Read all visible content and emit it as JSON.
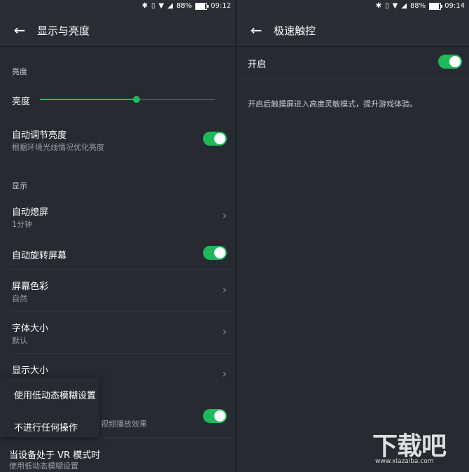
{
  "left": {
    "status": {
      "battery": "88%",
      "time": "09:12",
      "battery_level": 0.88
    },
    "header": {
      "title": "显示与亮度"
    },
    "brightness_section": "亮度",
    "brightness": {
      "label": "亮度",
      "level": 0.55
    },
    "auto_brightness": {
      "label": "自动调节亮度",
      "sub": "根据环境光线情况优化亮度",
      "on": true
    },
    "display_section": "显示",
    "auto_screen_off": {
      "label": "自动熄屏",
      "value": "1分钟"
    },
    "auto_rotate": {
      "label": "自动旋转屏幕",
      "on": true
    },
    "screen_color": {
      "label": "屏幕色彩",
      "value": "自然"
    },
    "font_size": {
      "label": "字体大小",
      "value": "默认"
    },
    "display_size": {
      "label": "显示大小"
    },
    "video_item": {
      "sub_partial": "视频播放效果",
      "on": true
    },
    "vr_mode": {
      "label": "当设备处于 VR 模式时",
      "sub": "使用低动态模糊设置"
    },
    "popup": {
      "items": [
        "使用低动态模糊设置",
        "不进行任何操作"
      ]
    }
  },
  "right": {
    "status": {
      "battery": "88%",
      "time": "09:14",
      "battery_level": 0.88
    },
    "header": {
      "title": "极速触控"
    },
    "enable": {
      "label": "开启",
      "on": true
    },
    "description": "开启后触摸屏进入高度灵敏模式，提升游戏体验。"
  },
  "watermark": {
    "logo": "下载吧",
    "url": "www.xiazaiba.com"
  },
  "colors": {
    "accent": "#1fb95b",
    "background": "#272b31"
  },
  "icons": [
    "bluetooth-icon",
    "vibrate-icon",
    "wifi-icon",
    "signal-icon",
    "battery-icon",
    "back-arrow-icon",
    "chevron-right-icon"
  ]
}
